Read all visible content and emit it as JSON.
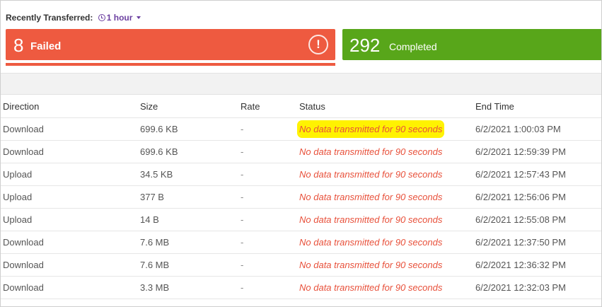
{
  "filter": {
    "label": "Recently Transferred:",
    "value": "1 hour",
    "icon": "clock-icon",
    "accent": "#6b3fa0"
  },
  "cards": {
    "failed": {
      "count": "8",
      "label": "Failed",
      "color": "#ee5a40",
      "icon": "alert-circle-icon",
      "icon_glyph": "!"
    },
    "completed": {
      "count": "292",
      "label": "Completed",
      "color": "#58a61a"
    }
  },
  "table": {
    "columns": [
      "Direction",
      "Size",
      "Rate",
      "Status",
      "End Time"
    ],
    "rows": [
      {
        "direction": "Download",
        "size": "699.6 KB",
        "rate": "-",
        "status": "No data transmitted for 90 seconds",
        "end_time": "6/2/2021 1:00:03 PM",
        "highlighted": true
      },
      {
        "direction": "Download",
        "size": "699.6 KB",
        "rate": "-",
        "status": "No data transmitted for 90 seconds",
        "end_time": "6/2/2021 12:59:39 PM"
      },
      {
        "direction": "Upload",
        "size": "34.5 KB",
        "rate": "-",
        "status": "No data transmitted for 90 seconds",
        "end_time": "6/2/2021 12:57:43 PM"
      },
      {
        "direction": "Upload",
        "size": "377 B",
        "rate": "-",
        "status": "No data transmitted for 90 seconds",
        "end_time": "6/2/2021 12:56:06 PM"
      },
      {
        "direction": "Upload",
        "size": "14 B",
        "rate": "-",
        "status": "No data transmitted for 90 seconds",
        "end_time": "6/2/2021 12:55:08 PM"
      },
      {
        "direction": "Download",
        "size": "7.6 MB",
        "rate": "-",
        "status": "No data transmitted for 90 seconds",
        "end_time": "6/2/2021 12:37:50 PM"
      },
      {
        "direction": "Download",
        "size": "7.6 MB",
        "rate": "-",
        "status": "No data transmitted for 90 seconds",
        "end_time": "6/2/2021 12:36:32 PM"
      },
      {
        "direction": "Download",
        "size": "3.3 MB",
        "rate": "-",
        "status": "No data transmitted for 90 seconds",
        "end_time": "6/2/2021 12:32:03 PM"
      }
    ]
  }
}
